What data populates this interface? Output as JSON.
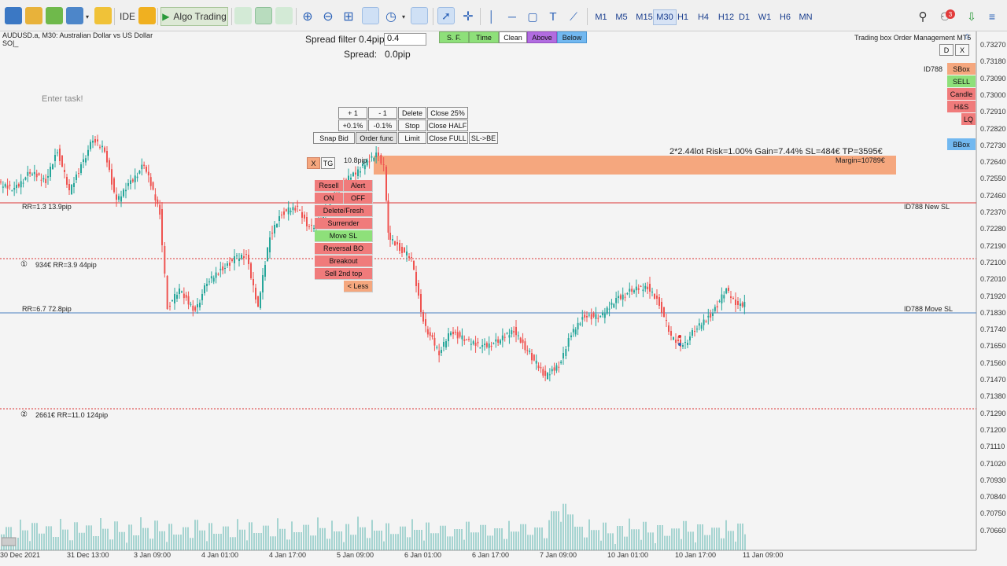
{
  "toolbar": {
    "ide_label": "IDE",
    "algo_label": "Algo Trading",
    "timeframes": [
      "M1",
      "M5",
      "M15",
      "M30",
      "H1",
      "H4",
      "H12",
      "D1",
      "W1",
      "H6",
      "MN"
    ],
    "active_timeframe": "M30",
    "notification_count": "3"
  },
  "chart": {
    "symbol_line": "AUDUSD.a, M30:  Australian Dollar vs US Dollar",
    "sub_line": "SO|_",
    "enter_task": "Enter task!",
    "spread_filter_label": "Spread filter 0.4pip",
    "spread_filter_value": "0.4",
    "spread_label": "Spread:",
    "spread_value": "0.0pip",
    "filter_buttons": [
      "S. F.",
      "Time",
      "Clean",
      "Above",
      "Below"
    ],
    "panel_title": "Trading box Order Management MT5",
    "panel_buttons": [
      "D",
      "X"
    ],
    "id_label": "ID788",
    "side_buttons": [
      "SBox",
      "SELL",
      "Candle",
      "H&S",
      "LQ",
      "BBox"
    ],
    "order_grid": [
      [
        "+ 1",
        "- 1",
        "Delete",
        "Close 25%"
      ],
      [
        "+0.1%",
        "-0.1%",
        "Stop",
        "Close HALF"
      ],
      [
        "Snap Bid",
        "Order func",
        "Limit",
        "Close FULL",
        "SL->BE"
      ]
    ],
    "x_label": "X",
    "tg_label": "TG",
    "pip_label": "10.8pip",
    "trade_info": "2*2.44lot  Risk=1.00%  Gain=7.44%  SL=484€  TP=3595€",
    "margin_label": "Margin=10789€",
    "red_menu": [
      "Resell",
      "Alert",
      "ON",
      "OFF",
      "Delete/Fresh",
      "Surrender",
      "Move SL",
      "Reversal BO",
      "Breakout",
      "Sell 2nd top",
      "< Less"
    ],
    "line_labels": {
      "sl_left": "RR=1.3   13.9pip",
      "sl_right": "ID788 New SL",
      "tp1": "934€   RR=3.9   44pip",
      "tp1_marker": "①",
      "move_left": "RR=6.7   72.8pip",
      "move_right": "ID788 Move SL",
      "tp2": "2661€   RR=11.0   124pip",
      "tp2_marker": "②"
    },
    "prices": [
      "0.73270",
      "0.73180",
      "0.73090",
      "0.73000",
      "0.72910",
      "0.72820",
      "0.72730",
      "0.72640",
      "0.72550",
      "0.72460",
      "0.72370",
      "0.72280",
      "0.72190",
      "0.72100",
      "0.72010",
      "0.71920",
      "0.71830",
      "0.71740",
      "0.71650",
      "0.71560",
      "0.71470",
      "0.71380",
      "0.71290",
      "0.71200",
      "0.71110",
      "0.71020",
      "0.70930",
      "0.70840",
      "0.70750",
      "0.70660"
    ],
    "times": [
      "30 Dec 2021",
      "31 Dec 13:00",
      "3 Jan 09:00",
      "4 Jan 01:00",
      "4 Jan 17:00",
      "5 Jan 09:00",
      "6 Jan 01:00",
      "6 Jan 17:00",
      "7 Jan 09:00",
      "10 Jan 01:00",
      "10 Jan 17:00",
      "11 Jan 09:00"
    ],
    "colors": {
      "up": "#26a69a",
      "down": "#ef5350",
      "orange_zone": "#f5a77e",
      "sl_line": "#d33",
      "move_line": "#4a7fc1"
    }
  }
}
